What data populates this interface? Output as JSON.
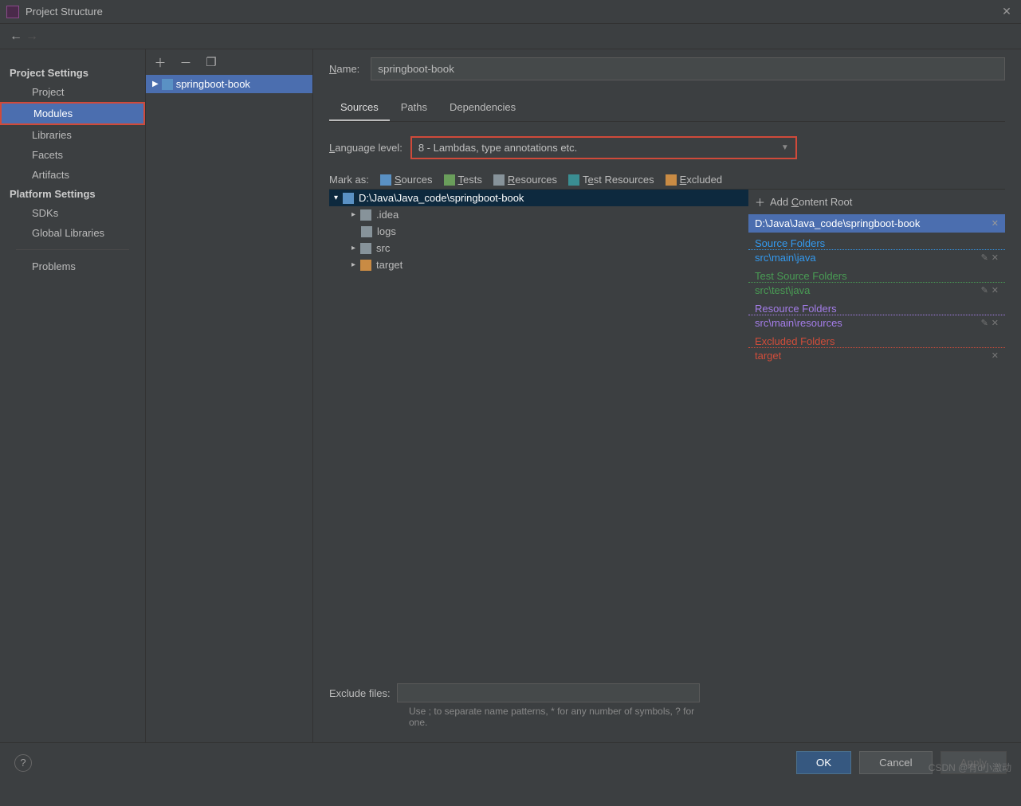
{
  "window": {
    "title": "Project Structure"
  },
  "nav": {
    "back_enabled": true,
    "forward_enabled": false
  },
  "sidebar": {
    "headings": {
      "project": "Project Settings",
      "platform": "Platform Settings"
    },
    "items": {
      "project": "Project",
      "modules": "Modules",
      "libraries": "Libraries",
      "facets": "Facets",
      "artifacts": "Artifacts",
      "sdks": "SDKs",
      "global_libraries": "Global Libraries",
      "problems": "Problems"
    }
  },
  "module_tree": {
    "root": "springboot-book"
  },
  "form": {
    "name_label": "Name:",
    "name_value": "springboot-book",
    "tabs": {
      "sources": "Sources",
      "paths": "Paths",
      "deps": "Dependencies"
    },
    "lang_label": "Language level:",
    "lang_value": "8 - Lambdas, type annotations etc.",
    "markas_label": "Mark as:",
    "marks": {
      "sources": "Sources",
      "tests": "Tests",
      "resources": "Resources",
      "test_resources": "Test Resources",
      "excluded": "Excluded"
    },
    "exclude_label": "Exclude files:",
    "exclude_hint": "Use ; to separate name patterns, * for any number of symbols, ? for one."
  },
  "tree": {
    "root": "D:\\Java\\Java_code\\springboot-book",
    "children": [
      ".idea",
      "logs",
      "src",
      "target"
    ]
  },
  "roots": {
    "add_label": "Add Content Root",
    "path": "D:\\Java\\Java_code\\springboot-book",
    "source_folders": {
      "title": "Source Folders",
      "items": [
        "src\\main\\java"
      ]
    },
    "test_folders": {
      "title": "Test Source Folders",
      "items": [
        "src\\test\\java"
      ]
    },
    "resource_folders": {
      "title": "Resource Folders",
      "items": [
        "src\\main\\resources"
      ]
    },
    "excluded_folders": {
      "title": "Excluded Folders",
      "items": [
        "target"
      ]
    }
  },
  "footer": {
    "ok": "OK",
    "cancel": "Cancel",
    "apply": "Apply"
  },
  "watermark": "CSDN @有d小激动"
}
